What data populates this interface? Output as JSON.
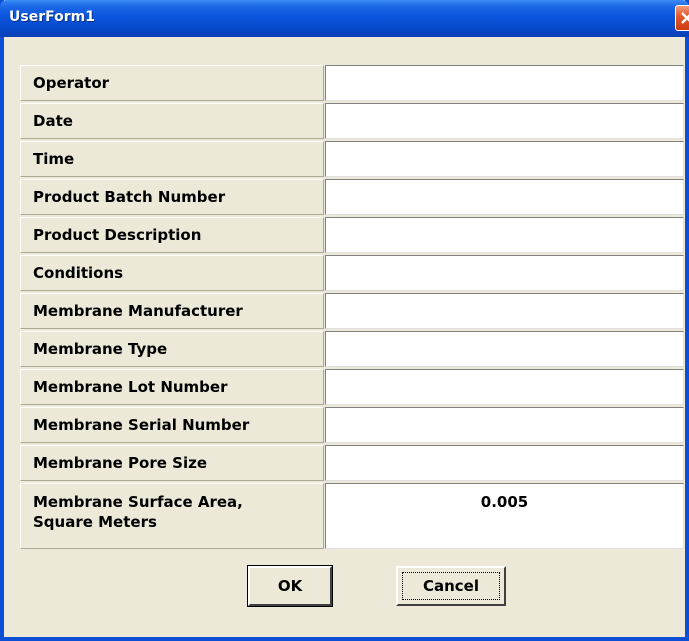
{
  "window": {
    "title": "UserForm1"
  },
  "form": {
    "fields": [
      {
        "label": "Operator",
        "value": ""
      },
      {
        "label": "Date",
        "value": ""
      },
      {
        "label": "Time",
        "value": ""
      },
      {
        "label": "Product Batch Number",
        "value": ""
      },
      {
        "label": "Product Description",
        "value": ""
      },
      {
        "label": "Conditions",
        "value": ""
      },
      {
        "label": "Membrane Manufacturer",
        "value": ""
      },
      {
        "label": "Membrane Type",
        "value": ""
      },
      {
        "label": "Membrane Lot Number",
        "value": ""
      },
      {
        "label": "Membrane Serial Number",
        "value": ""
      },
      {
        "label": "Membrane Pore Size",
        "value": ""
      },
      {
        "label": "Membrane Surface Area,",
        "label_line2": "Square Meters",
        "value": "0.005"
      }
    ]
  },
  "buttons": {
    "ok_label": "OK",
    "cancel_label": "Cancel"
  },
  "colors": {
    "titlebar": "#0a55dd",
    "window_bg": "#ece9d8",
    "close_button": "#e35a2f"
  }
}
